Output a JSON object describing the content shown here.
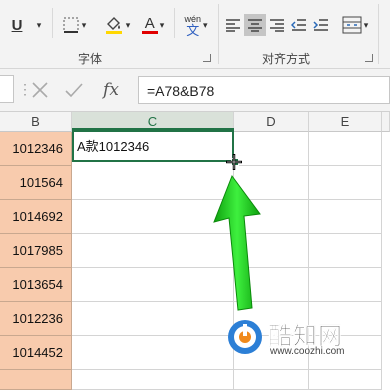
{
  "ribbon": {
    "font_group_label": "字体",
    "align_group_label": "对齐方式",
    "underline_label": "U",
    "font_color_label": "A",
    "phonetic_label": "wén",
    "phonetic_char": "文"
  },
  "formula_bar": {
    "cancel_icon": "cancel-icon",
    "enter_icon": "check-icon",
    "fx_label": "fx",
    "formula": "=A78&B78"
  },
  "columns": [
    "B",
    "C",
    "D",
    "E"
  ],
  "selected_column": "C",
  "cells": {
    "b_values": [
      "1012346",
      "101564",
      "1014692",
      "1017985",
      "1013654",
      "1012236",
      "1014452"
    ],
    "c_first": "A款1012346"
  },
  "watermark": {
    "brand": "酷知网",
    "url": "www.coozhi.com"
  },
  "colors": {
    "b_fill": "#f8cbad",
    "selection": "#217346",
    "arrow": "#1fd11f"
  }
}
